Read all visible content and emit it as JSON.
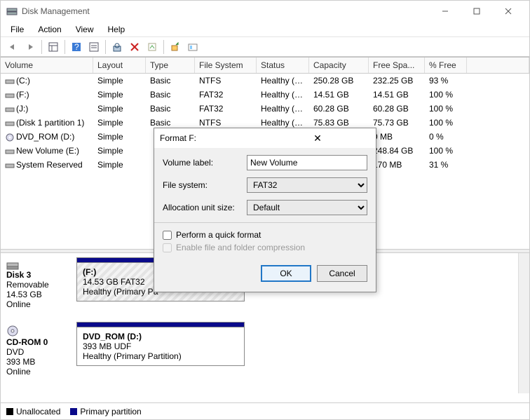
{
  "window": {
    "title": "Disk Management"
  },
  "menu": {
    "file": "File",
    "action": "Action",
    "view": "View",
    "help": "Help"
  },
  "columns": {
    "volume": "Volume",
    "layout": "Layout",
    "type": "Type",
    "fs": "File System",
    "status": "Status",
    "capacity": "Capacity",
    "free": "Free Spa...",
    "pct": "% Free"
  },
  "rows": [
    {
      "vol": "(C:)",
      "layout": "Simple",
      "type": "Basic",
      "fs": "NTFS",
      "status": "Healthy (B...",
      "cap": "250.28 GB",
      "free": "232.25 GB",
      "pct": "93 %"
    },
    {
      "vol": "(F:)",
      "layout": "Simple",
      "type": "Basic",
      "fs": "FAT32",
      "status": "Healthy (P...",
      "cap": "14.51 GB",
      "free": "14.51 GB",
      "pct": "100 %"
    },
    {
      "vol": "(J:)",
      "layout": "Simple",
      "type": "Basic",
      "fs": "FAT32",
      "status": "Healthy (P...",
      "cap": "60.28 GB",
      "free": "60.28 GB",
      "pct": "100 %"
    },
    {
      "vol": "(Disk 1 partition 1)",
      "layout": "Simple",
      "type": "Basic",
      "fs": "NTFS",
      "status": "Healthy (P...",
      "cap": "75.83 GB",
      "free": "75.73 GB",
      "pct": "100 %"
    },
    {
      "vol": "DVD_ROM (D:)",
      "layout": "Simple",
      "type": "",
      "fs": "",
      "status": "",
      "cap": "",
      "free": "0 MB",
      "pct": "0 %"
    },
    {
      "vol": "New Volume (E:)",
      "layout": "Simple",
      "type": "",
      "fs": "",
      "status": "",
      "cap": "",
      "free": "248.84 GB",
      "pct": "100 %"
    },
    {
      "vol": "System Reserved",
      "layout": "Simple",
      "type": "",
      "fs": "",
      "status": "",
      "cap": "",
      "free": "170 MB",
      "pct": "31 %"
    }
  ],
  "disk3": {
    "name": "Disk 3",
    "type": "Removable",
    "size": "14.53 GB",
    "state": "Online",
    "part_label": "(F:)",
    "part_size": "14.53 GB FAT32",
    "part_status": "Healthy (Primary Pa"
  },
  "cdrom": {
    "name": "CD-ROM 0",
    "type": "DVD",
    "size": "393 MB",
    "state": "Online",
    "part_label": "DVD_ROM  (D:)",
    "part_size": "393 MB UDF",
    "part_status": "Healthy (Primary Partition)"
  },
  "legend": {
    "unalloc": "Unallocated",
    "primary": "Primary partition"
  },
  "dialog": {
    "title": "Format F:",
    "vol_label_lbl": "Volume label:",
    "vol_label_val": "New Volume",
    "fs_lbl": "File system:",
    "fs_val": "FAT32",
    "alloc_lbl": "Allocation unit size:",
    "alloc_val": "Default",
    "quick": "Perform a quick format",
    "compress": "Enable file and folder compression",
    "ok": "OK",
    "cancel": "Cancel"
  }
}
